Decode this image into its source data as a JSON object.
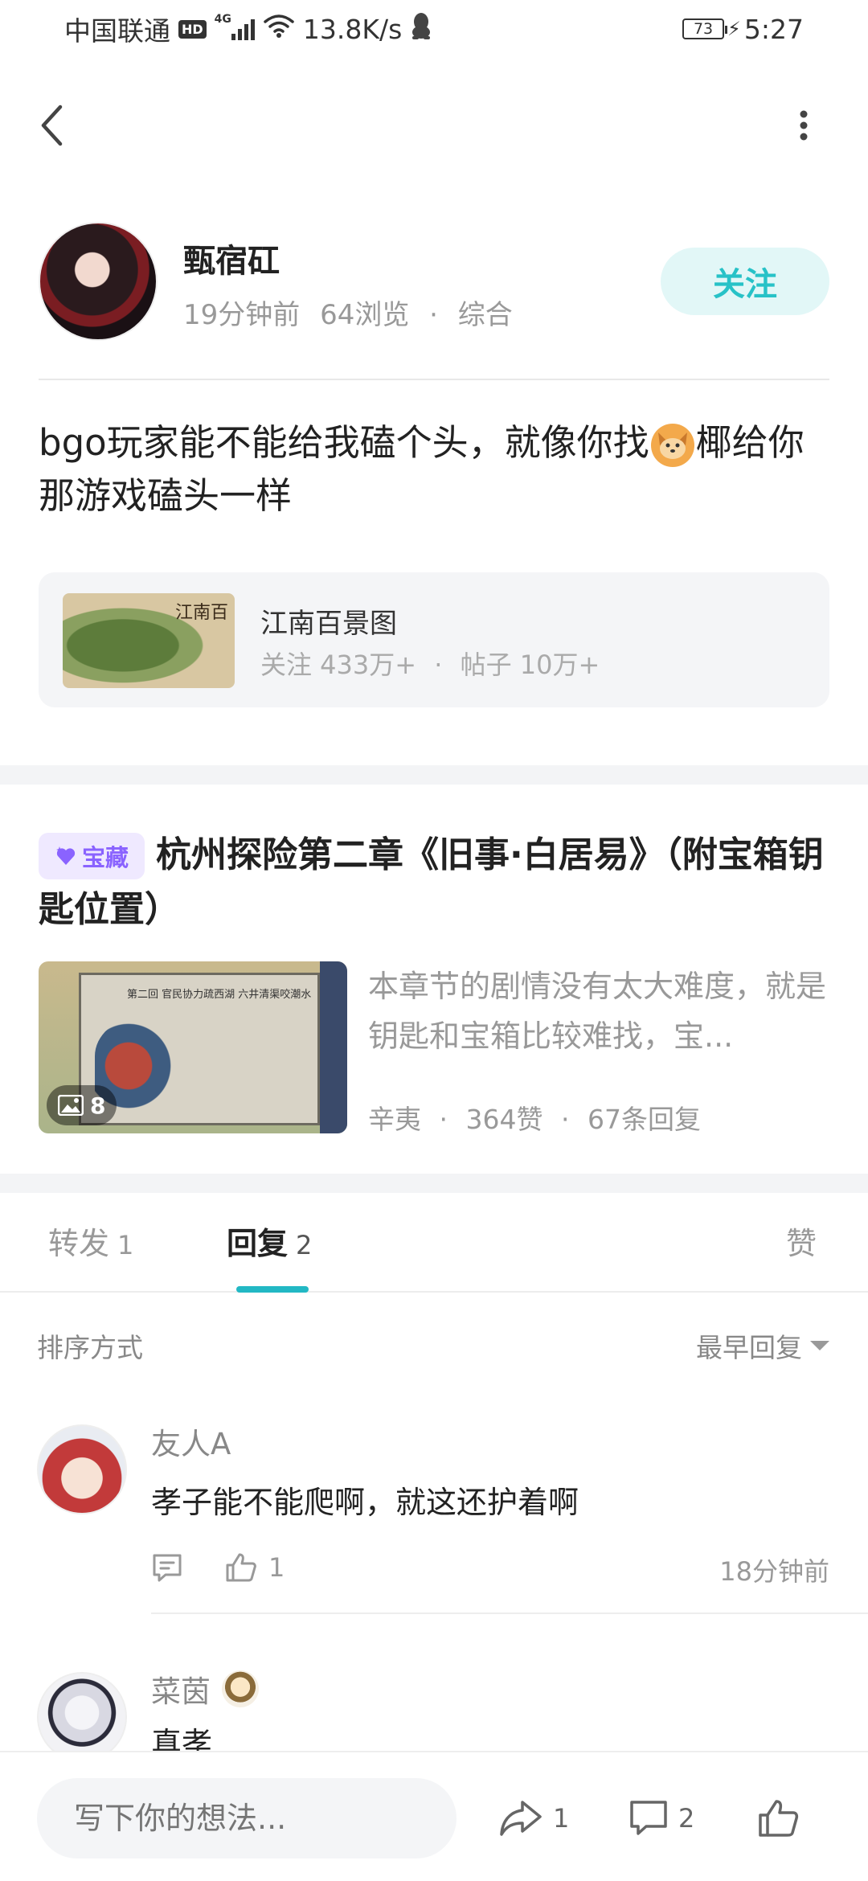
{
  "status_bar": {
    "carrier": "中国联通",
    "hd": "HD",
    "network": "4G",
    "speed": "13.8K/s",
    "battery": "73",
    "time": "5:27"
  },
  "nav": {
    "back_icon": "chevron-left-icon",
    "more_icon": "vertical-dots-icon"
  },
  "author": {
    "name": "甄宿矼",
    "time_ago": "19分钟前",
    "views": "64浏览",
    "separator": "·",
    "category": "综合",
    "follow_label": "关注"
  },
  "post": {
    "text_before": "bgo玩家能不能给我磕个头，就像你找",
    "emoji": "dog-face-emoji",
    "text_after": "椰给你那游戏磕头一样"
  },
  "forum": {
    "name": "江南百景图",
    "thumb_text": "江南百",
    "followers_label": "关注 433万+",
    "separator": "·",
    "posts_label": "帖子 10万+"
  },
  "article": {
    "badge": "宝藏",
    "title": "杭州探险第二章《旧事·白居易》（附宝箱钥匙位置）",
    "excerpt": "本章节的剧情没有太大难度，就是钥匙和宝箱比较难找，宝...",
    "image_count": "8",
    "author": "辛夷",
    "separator": "·",
    "likes": "364赞",
    "replies": "67条回复",
    "thumb_title": "第二回 官民协力疏西湖 六井清渠咬潮水"
  },
  "tabs": {
    "forward_label": "转发",
    "forward_count": "1",
    "reply_label": "回复",
    "reply_count": "2",
    "like_label": "赞"
  },
  "sort": {
    "label": "排序方式",
    "selected": "最早回复"
  },
  "comments": [
    {
      "name": "友人A",
      "text": "孝子能不能爬啊，就这还护着啊",
      "likes": "1",
      "time": "18分钟前"
    },
    {
      "name": "菜茵",
      "text": "真孝"
    }
  ],
  "bottom_bar": {
    "placeholder": "写下你的想法...",
    "share_count": "1",
    "comment_count": "2"
  },
  "colors": {
    "accent": "#27c2c7",
    "follow_bg": "#e2f7f7",
    "badge_purple": "#8a63ff",
    "badge_bg": "#efe9ff",
    "tab_indicator": "#22b8c4"
  }
}
